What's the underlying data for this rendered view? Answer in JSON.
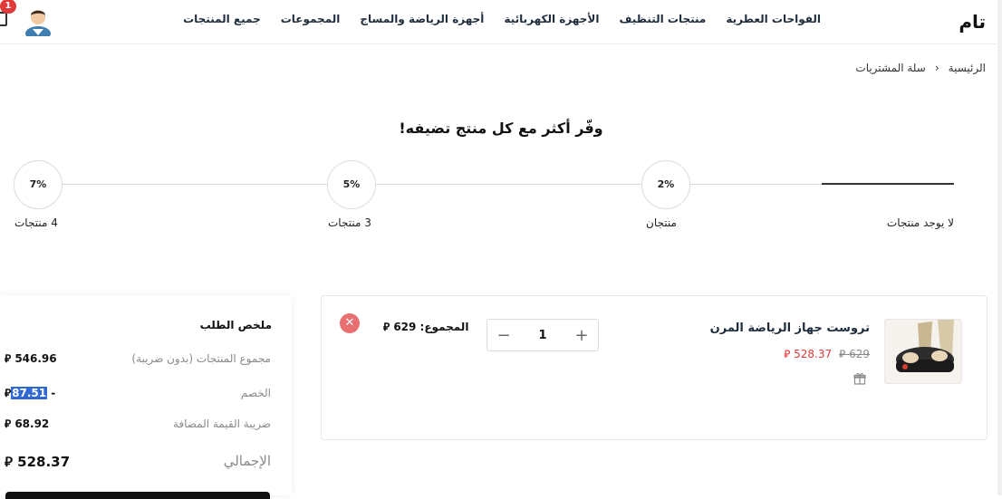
{
  "header": {
    "logo": "تام",
    "nav": [
      "جميع المنتجات",
      "المجموعات",
      "أجهزة الرياضة والمساج",
      "الأجهزة الكهربائية",
      "منتجات التنظيف",
      "الفواحات العطرية"
    ],
    "cart_badge": "1",
    "icons": {
      "avatar": "user-avatar-icon",
      "cart": "cart-icon"
    }
  },
  "breadcrumb": {
    "home": "الرئيسية",
    "separator": "‹",
    "current": "سلة المشتريات"
  },
  "promo": {
    "headline": "وفّر أكثر مع كل منتج تضيفه!",
    "tiers": [
      {
        "label": "لا يوجد منتجات",
        "discount": ""
      },
      {
        "label": "منتجان",
        "discount": "2%"
      },
      {
        "label": "3 منتجات",
        "discount": "5%"
      },
      {
        "label": "4 منتجات",
        "discount": "7%"
      }
    ]
  },
  "cart_item": {
    "name": "تروست جهاز الرياضة المرن",
    "old_price": "629 ⃁",
    "new_price": "528.37 ⃁",
    "quantity": "1",
    "subtotal": "المجموع: 629 ⃁",
    "remove_icon": "close-icon",
    "gift_icon": "gift-icon"
  },
  "summary": {
    "title": "ملخص الطلب",
    "rows": [
      {
        "label": "مجموع المنتجات (بدون ضريبة)",
        "value": "546.96 ⃁"
      },
      {
        "label": "الخصم",
        "value_prefix": "- ",
        "value": "87.51",
        "currency": "⃁"
      },
      {
        "label": "ضريبة القيمة المضافة",
        "value": "68.92 ⃁"
      }
    ],
    "total_label": "الإجمالي",
    "total_value": "528.37 ⃁"
  },
  "colors": {
    "accent_red": "#e03a3a",
    "remove_red": "#e97070",
    "highlight_blue": "#2f68d0"
  }
}
